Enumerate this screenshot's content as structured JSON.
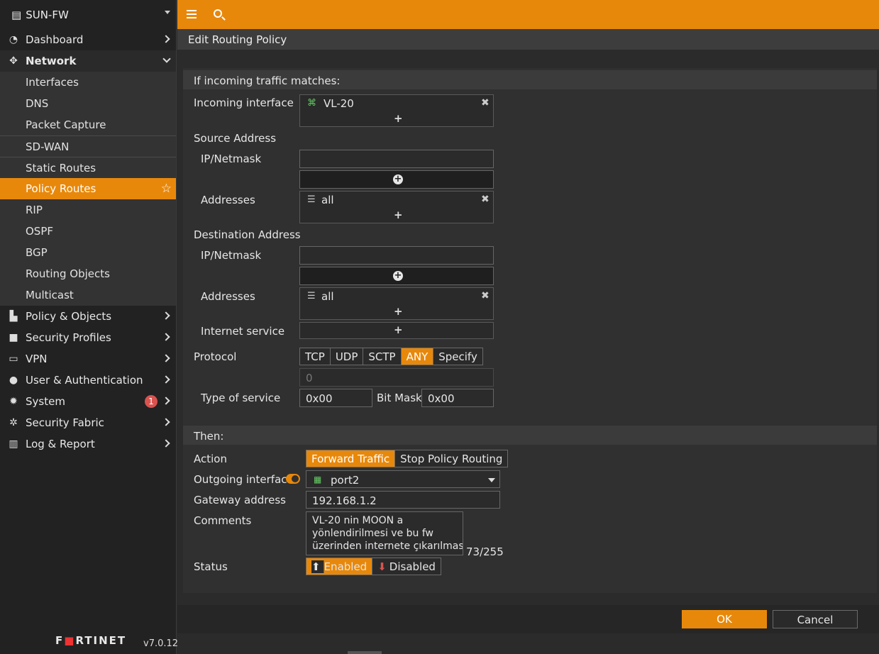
{
  "sidebar": {
    "device": "SUN-FW",
    "items": [
      {
        "label": "Dashboard",
        "icon": "dashboard-gauge-icon"
      },
      {
        "label": "Network",
        "icon": "network-move-icon",
        "open": true
      }
    ],
    "network_sub": [
      "Interfaces",
      "DNS",
      "Packet Capture",
      "SD-WAN",
      "Static Routes",
      "Policy Routes",
      "RIP",
      "OSPF",
      "BGP",
      "Routing Objects",
      "Multicast"
    ],
    "items_after": [
      {
        "label": "Policy & Objects",
        "icon": "policy-clipboard-icon"
      },
      {
        "label": "Security Profiles",
        "icon": "lock-icon"
      },
      {
        "label": "VPN",
        "icon": "laptop-icon"
      },
      {
        "label": "User & Authentication",
        "icon": "user-icon"
      },
      {
        "label": "System",
        "icon": "gear-icon",
        "badge": "1"
      },
      {
        "label": "Security Fabric",
        "icon": "fabric-icon"
      },
      {
        "label": "Log & Report",
        "icon": "chart-icon"
      }
    ],
    "logo": "F𝗘RTINET",
    "version": "v7.0.12"
  },
  "page": {
    "title": "Edit Routing Policy"
  },
  "match": {
    "header": "If incoming traffic matches:",
    "incoming_interface_label": "Incoming interface",
    "incoming_interface_value": "VL-20",
    "source_address_label": "Source Address",
    "ip_netmask_label": "IP/Netmask",
    "addresses_label": "Addresses",
    "source_addresses_value": "all",
    "destination_address_label": "Destination Address",
    "dest_ip_netmask_label": "IP/Netmask",
    "dest_addresses_label": "Addresses",
    "dest_addresses_value": "all",
    "internet_service_label": "Internet service",
    "protocol_label": "Protocol",
    "protocol_options": [
      "TCP",
      "UDP",
      "SCTP",
      "ANY",
      "Specify"
    ],
    "protocol_selected": "ANY",
    "protocol_number": "0",
    "type_of_service_label": "Type of service",
    "type_of_service_value": "0x00",
    "bit_mask_label": "Bit Mask",
    "bit_mask_value": "0x00"
  },
  "then": {
    "header": "Then:",
    "action_label": "Action",
    "action_options": [
      "Forward Traffic",
      "Stop Policy Routing"
    ],
    "action_selected": "Forward Traffic",
    "outgoing_interface_label": "Outgoing interface",
    "outgoing_interface_value": "port2",
    "gateway_label": "Gateway address",
    "gateway_value": "192.168.1.2",
    "comments_label": "Comments",
    "comments_lines": [
      "VL-20 nin MOON a",
      "yönlendirilmesi ve bu fw",
      "üzerinden internete çıkarılması"
    ],
    "comments_count": "73/255",
    "status_label": "Status",
    "status_enabled": "Enabled",
    "status_disabled": "Disabled"
  },
  "footer": {
    "ok": "OK",
    "cancel": "Cancel"
  },
  "colors": {
    "accent": "#e8880b",
    "badge": "#d9534f"
  }
}
